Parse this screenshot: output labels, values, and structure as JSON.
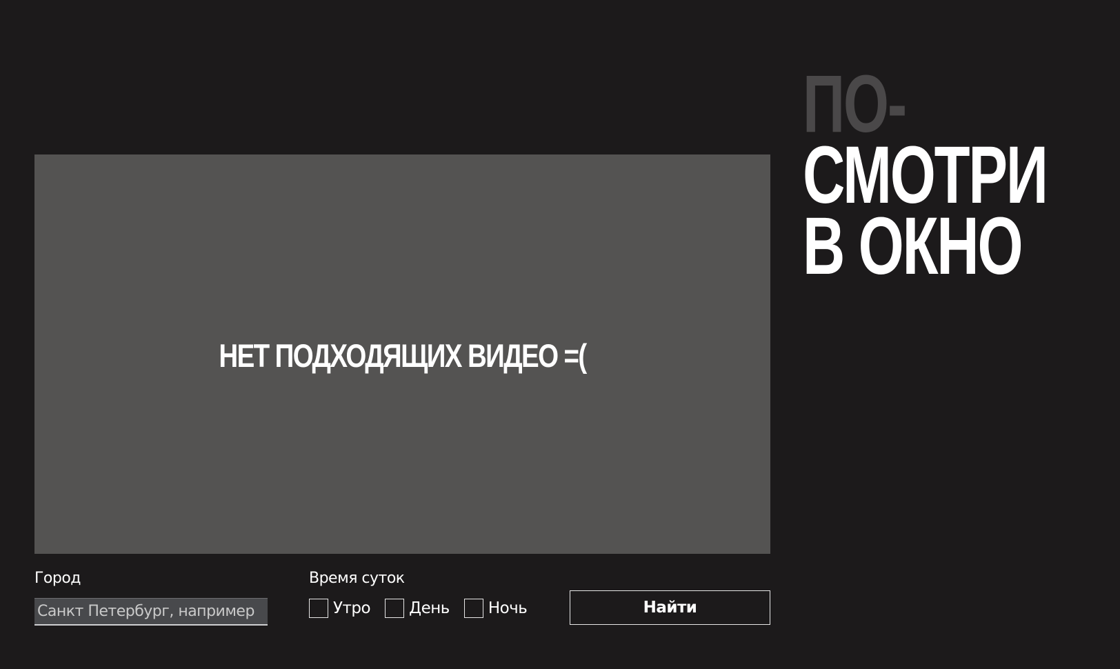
{
  "title": {
    "line1": "ПО-",
    "line2": "СМОТРИ",
    "line3": "В ОКНО"
  },
  "video": {
    "empty_message": "НЕТ ПОДХОДЯЩИХ ВИДЕО =("
  },
  "filters": {
    "city_label": "Город",
    "city_value": "",
    "city_placeholder": "Санкт Петербург, например",
    "time_label": "Время суток",
    "times": [
      {
        "label": "Утро",
        "checked": false
      },
      {
        "label": "День",
        "checked": false
      },
      {
        "label": "Ночь",
        "checked": false
      }
    ]
  },
  "actions": {
    "find_label": "Найти"
  },
  "colors": {
    "background": "#1c1a1b",
    "video_area": "#545352",
    "title_dim": "#4a4849",
    "text": "#ffffff"
  }
}
